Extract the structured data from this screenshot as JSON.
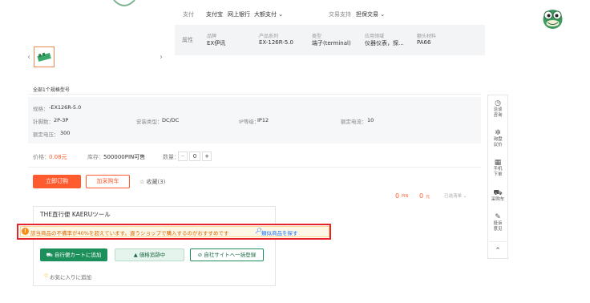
{
  "payment": {
    "label": "支付",
    "options": [
      "支付宝",
      "网上银行",
      "大额支付 ⌄"
    ]
  },
  "trade_support": {
    "label": "交易支持",
    "value": "担保交易 ⌄"
  },
  "attributes": {
    "title": "属性",
    "columns": [
      {
        "name": "品牌",
        "value": "EX伊讯"
      },
      {
        "name": "产品系列",
        "value": "EX-126R-5.0"
      },
      {
        "name": "类型",
        "value": "端子(terminal)"
      },
      {
        "name": "应用领域",
        "value": "仪器仪表，探..."
      },
      {
        "name": "额头材料",
        "value": "PA66"
      }
    ]
  },
  "carousel": {
    "prev": "‹",
    "next": "›"
  },
  "section_title": "全部1个规格型号",
  "specs": {
    "row1": {
      "label": "规格：",
      "value": "-EX126R-5.0"
    },
    "row2": [
      {
        "label": "针脚数：",
        "value": "2P-3P"
      },
      {
        "label": "安装类型：",
        "value": "DC/DC"
      },
      {
        "label": "IP等级：",
        "value": "IP12"
      },
      {
        "label": "额定电流：",
        "value": "10"
      }
    ],
    "row3": {
      "label": "额定电压：",
      "value": "300"
    }
  },
  "price_row": {
    "price_label": "价格：",
    "price_value": "0.08元",
    "stock_label": "库存：",
    "stock_value": "500000PIN可售",
    "qty_label": "数量：",
    "qty_minus": "−",
    "qty_value": "0",
    "qty_plus": "+"
  },
  "actions": {
    "buy": "立即订购",
    "cart": "加采购车",
    "favorite": "☆ 收藏(3)"
  },
  "counters": {
    "pin_count": "0",
    "pin_unit": "PIN",
    "yuan_count": "0",
    "yuan_unit": "元",
    "list": "已选清单 ⌄"
  },
  "panel": {
    "title": "THE直行便 KAERUツール",
    "btn_add": "自行便カートに追加",
    "btn_track": "価格追跡中",
    "btn_register": "自社サイトへ一括登録",
    "fav": "お気に入りに追加"
  },
  "warning": {
    "icon": "!",
    "text": "該当商品の不備率が40%を超えています。違うショップで購入するのがおすすめです",
    "link": "類似商品を探す"
  },
  "sidebar": [
    {
      "icon": "clock-icon",
      "glyph": "◷",
      "label": "洽谈\n咨询"
    },
    {
      "icon": "gear-icon",
      "glyph": "✲",
      "label": "询盘\n议价"
    },
    {
      "icon": "qr-icon",
      "glyph": "▦",
      "label": "手机\n下单"
    },
    {
      "icon": "cart-icon",
      "glyph": "⛟",
      "label": "采购车"
    },
    {
      "icon": "edit-icon",
      "glyph": "✎",
      "label": "投诉\n意见"
    },
    {
      "icon": "up-icon",
      "glyph": "⌃",
      "label": ""
    }
  ],
  "colors": {
    "accent": "#ff5b2e",
    "green": "#1d8f5b",
    "warning_border": "#e3242b",
    "link": "#1677ff"
  }
}
